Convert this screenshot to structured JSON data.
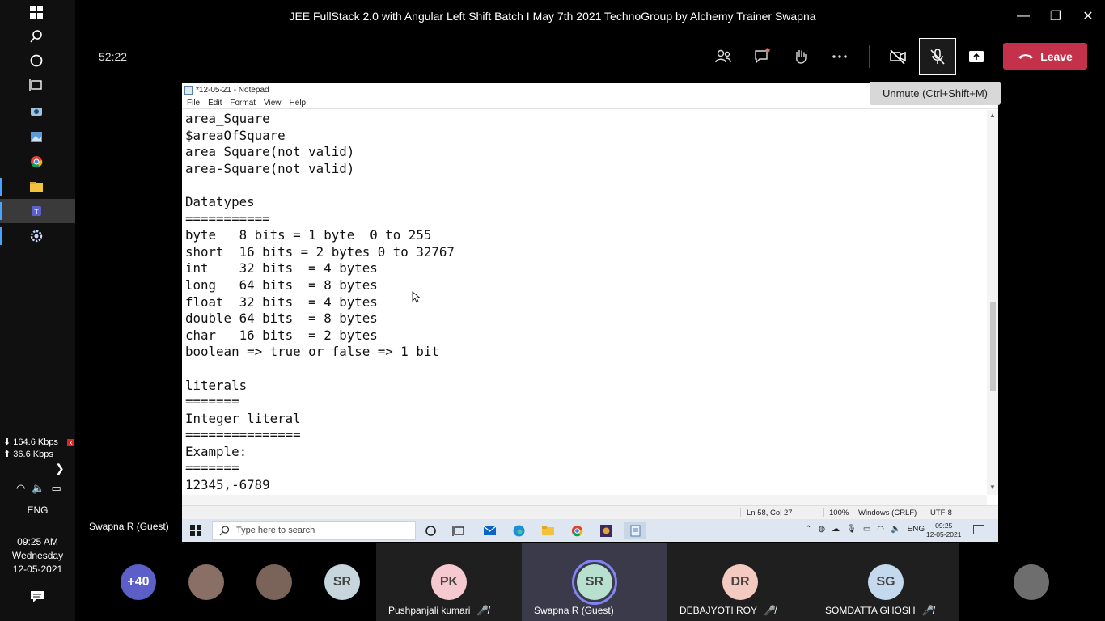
{
  "meeting": {
    "title": "JEE FullStack 2.0 with Angular Left Shift Batch I May 7th 2021 TechnoGroup by Alchemy Trainer Swapna",
    "timer": "52:22",
    "leave_label": "Leave",
    "tooltip": "Unmute (Ctrl+Shift+M)",
    "presenter_label": "Swapna R (Guest)",
    "accent_color": "#c4314b"
  },
  "left_taskbar": {
    "net_down": "164.6 Kbps",
    "net_up": "36.6 Kbps",
    "language": "ENG",
    "time": "09:25 AM",
    "day": "Wednesday",
    "date": "12-05-2021"
  },
  "notepad": {
    "title": "*12-05-21 - Notepad",
    "menu": [
      "File",
      "Edit",
      "Format",
      "View",
      "Help"
    ],
    "lines": [
      "area_Square",
      "$areaOfSquare",
      "area Square(not valid)",
      "area-Square(not valid)",
      "",
      "Datatypes",
      "===========",
      "byte   8 bits = 1 byte  0 to 255",
      "short  16 bits = 2 bytes 0 to 32767",
      "int    32 bits  = 4 bytes",
      "long   64 bits  = 8 bytes",
      "float  32 bits  = 4 bytes",
      "double 64 bits  = 8 bytes",
      "char   16 bits  = 2 bytes",
      "boolean => true or false => 1 bit",
      "",
      "literals",
      "=======",
      "Integer literal",
      "===============",
      "Example:",
      "=======",
      "12345,-6789"
    ],
    "status": {
      "position": "Ln 58, Col 27",
      "zoom": "100%",
      "line_ending": "Windows (CRLF)",
      "encoding": "UTF-8"
    }
  },
  "inner_taskbar": {
    "search_placeholder": "Type here to search",
    "language": "ENG",
    "time": "09:25",
    "date": "12-05-2021"
  },
  "participants": [
    {
      "initials": "+40",
      "name": "",
      "color": "#5b5fc7"
    },
    {
      "initials": "",
      "name": "",
      "color": "#8a6f66"
    },
    {
      "initials": "",
      "name": "",
      "color": "#7a6358"
    },
    {
      "initials": "SR",
      "name": "",
      "color": "#c7d5dc"
    },
    {
      "initials": "PK",
      "name": "Pushpanjali kumari",
      "color": "#f6c8cf"
    },
    {
      "initials": "SR",
      "name": "Swapna R (Guest)",
      "color": "#b8e0cf"
    },
    {
      "initials": "DR",
      "name": "DEBAJYOTI ROY",
      "color": "#f4c9c0"
    },
    {
      "initials": "SG",
      "name": "SOMDATTA GHOSH",
      "color": "#c5d9ee"
    },
    {
      "initials": "",
      "name": "",
      "color": "#6e6e6e"
    }
  ]
}
